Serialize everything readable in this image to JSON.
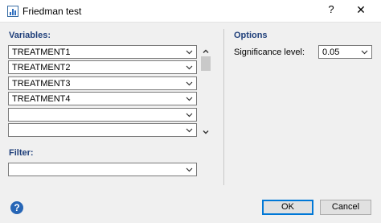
{
  "window": {
    "title": "Friedman test",
    "help_symbol": "?",
    "close_symbol": "✕",
    "app_icon": "chart-icon"
  },
  "variables": {
    "title": "Variables:",
    "rows": [
      "TREATMENT1",
      "TREATMENT2",
      "TREATMENT3",
      "TREATMENT4",
      "",
      ""
    ]
  },
  "filter": {
    "title": "Filter:",
    "value": ""
  },
  "options": {
    "title": "Options",
    "significance_label": "Significance level:",
    "significance_value": "0.05"
  },
  "buttons": {
    "ok": "OK",
    "cancel": "Cancel",
    "help_symbol": "?"
  },
  "colors": {
    "section_title": "#1f3f7a",
    "accent": "#0078d7",
    "help": "#2766b6"
  }
}
